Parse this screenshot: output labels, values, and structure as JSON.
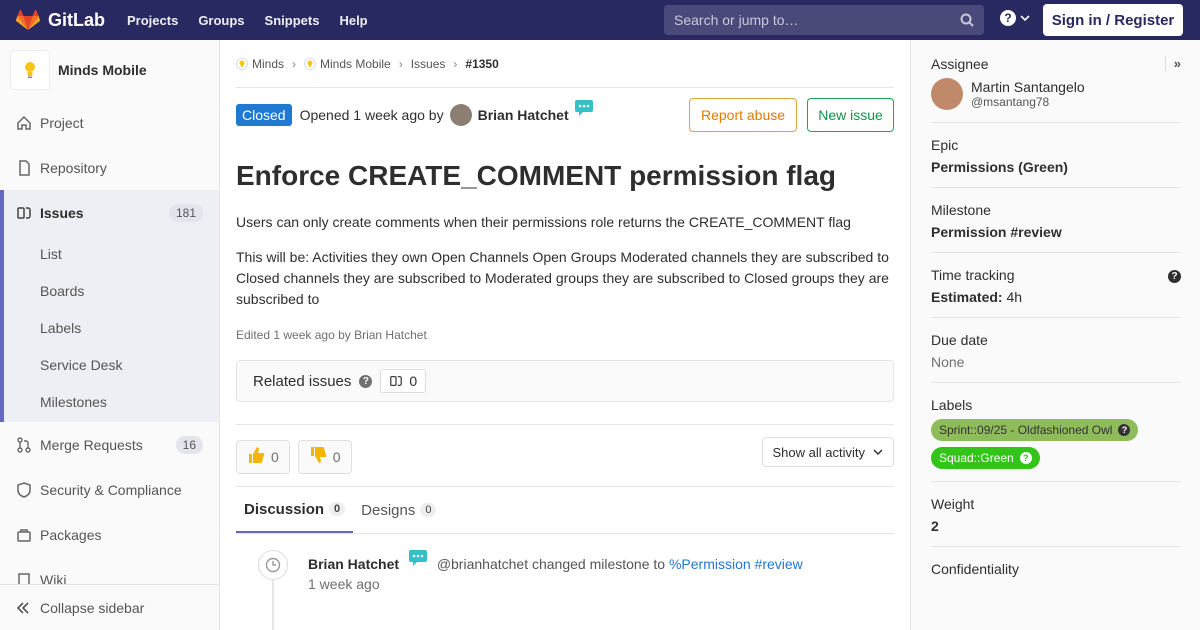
{
  "navbar": {
    "logo_text": "GitLab",
    "links": [
      "Projects",
      "Groups",
      "Snippets",
      "Help"
    ],
    "search_placeholder": "Search or jump to…",
    "signin_label": "Sign in / Register",
    "help_glyph": "?"
  },
  "sidebar": {
    "project_name": "Minds Mobile",
    "items": {
      "project": "Project",
      "repository": "Repository",
      "issues": "Issues",
      "issues_count": "181",
      "merge_requests": "Merge Requests",
      "mr_count": "16",
      "security": "Security & Compliance",
      "packages": "Packages",
      "wiki_partial": "Wiki"
    },
    "issues_sub": [
      "List",
      "Boards",
      "Labels",
      "Service Desk",
      "Milestones"
    ],
    "collapse_label": "Collapse sidebar"
  },
  "breadcrumb": {
    "items": [
      "Minds",
      "Minds Mobile",
      "Issues",
      "#1350"
    ]
  },
  "issue": {
    "status": "Closed",
    "opened_text": "Opened 1 week ago by",
    "author": "Brian Hatchet",
    "report_abuse": "Report abuse",
    "new_issue": "New issue",
    "title": "Enforce CREATE_COMMENT permission flag",
    "desc_1": "Users can only create comments when their permissions role returns the CREATE_COMMENT flag",
    "desc_2": "This will be: Activities they own Open Channels Open Groups Moderated channels they are subscribed to Closed channels they are subscribed to Moderated groups they are subscribed to Closed groups they are subscribed to",
    "edited": "Edited 1 week ago by Brian Hatchet",
    "related_label": "Related issues",
    "related_count": "0",
    "thumbs_up": "0",
    "thumbs_down": "0",
    "activity_filter": "Show all activity"
  },
  "tabs": {
    "discussion": "Discussion",
    "discussion_count": "0",
    "designs": "Designs",
    "designs_count": "0"
  },
  "note": {
    "author": "Brian Hatchet",
    "text": "@brianhatchet changed milestone to",
    "link": "%Permission #review",
    "time": "1 week ago"
  },
  "right": {
    "assignee_label": "Assignee",
    "assignee_name": "Martin Santangelo",
    "assignee_user": "@msantang78",
    "epic_label": "Epic",
    "epic_value": "Permissions (Green)",
    "milestone_label": "Milestone",
    "milestone_value": "Permission #review",
    "time_label": "Time tracking",
    "estimated_label": "Estimated:",
    "estimated_value": "4h",
    "due_label": "Due date",
    "due_value": "None",
    "labels_label": "Labels",
    "label_1": "Sprint::09/25 - Oldfashioned Owl",
    "label_2": "Squad::Green",
    "weight_label": "Weight",
    "weight_value": "2",
    "confidentiality_label": "Confidentiality"
  },
  "colors": {
    "navbar": "#292961",
    "closed_badge": "#1f78d1",
    "label_sprint": "#8fbc5a",
    "label_squad": "#33c41a"
  }
}
